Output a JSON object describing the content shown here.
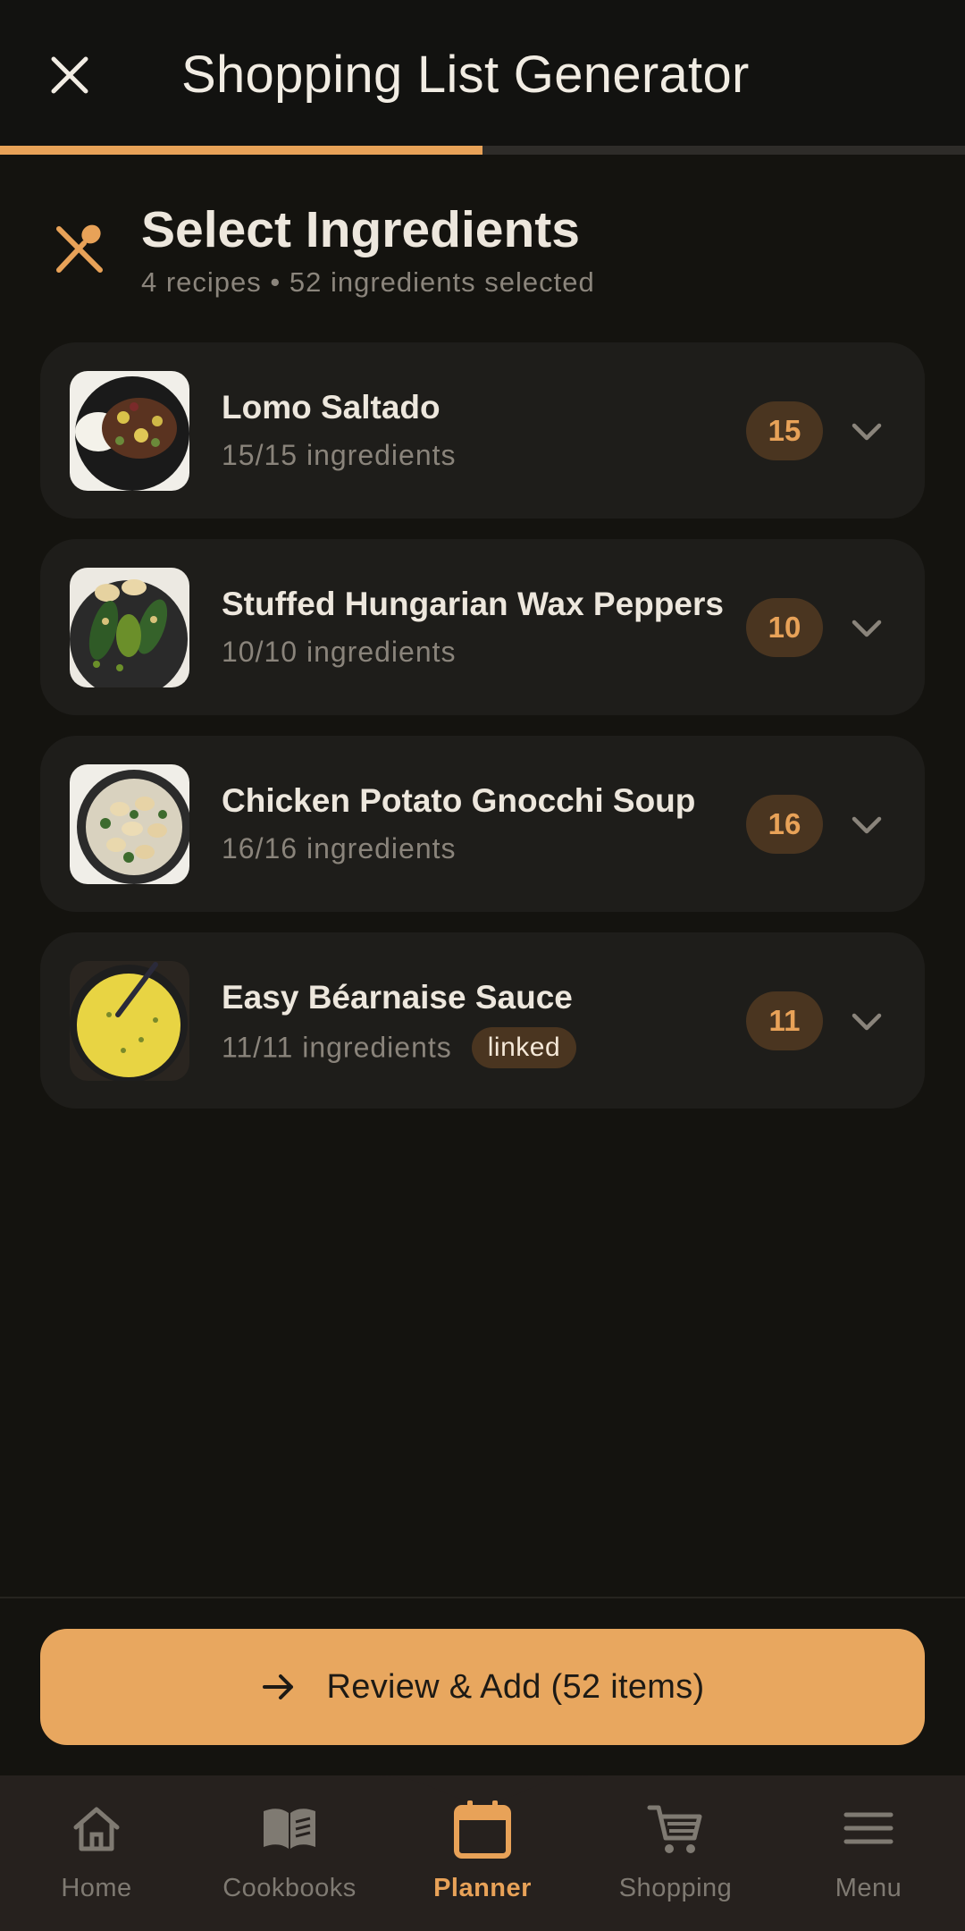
{
  "header": {
    "title": "Shopping List Generator",
    "close_icon": "close-icon"
  },
  "progress": {
    "fraction": 0.5
  },
  "section": {
    "icon": "utensils-icon",
    "title": "Select Ingredients",
    "subtitle": "4 recipes • 52 ingredients selected"
  },
  "recipes": [
    {
      "name": "Lomo Saltado",
      "ingredients": "15/15 ingredients",
      "count": "15",
      "linked": ""
    },
    {
      "name": "Stuffed Hungarian Wax Peppers",
      "ingredients": "10/10 ingredients",
      "count": "10",
      "linked": ""
    },
    {
      "name": "Chicken Potato Gnocchi Soup",
      "ingredients": "16/16 ingredients",
      "count": "16",
      "linked": ""
    },
    {
      "name": "Easy Béarnaise Sauce",
      "ingredients": "11/11 ingredients",
      "count": "11",
      "linked": "linked"
    }
  ],
  "action": {
    "label": "Review & Add (52 items)",
    "icon": "arrow-right-icon"
  },
  "nav": {
    "items": [
      {
        "label": "Home",
        "icon": "home-icon"
      },
      {
        "label": "Cookbooks",
        "icon": "book-icon"
      },
      {
        "label": "Planner",
        "icon": "calendar-icon",
        "active": true
      },
      {
        "label": "Shopping",
        "icon": "cart-icon"
      },
      {
        "label": "Menu",
        "icon": "menu-icon"
      }
    ]
  },
  "colors": {
    "accent": "#e8a258",
    "background": "#14130f",
    "card": "#1e1d1a",
    "badge_bg": "#4a3520",
    "button": "#e8a75f"
  }
}
